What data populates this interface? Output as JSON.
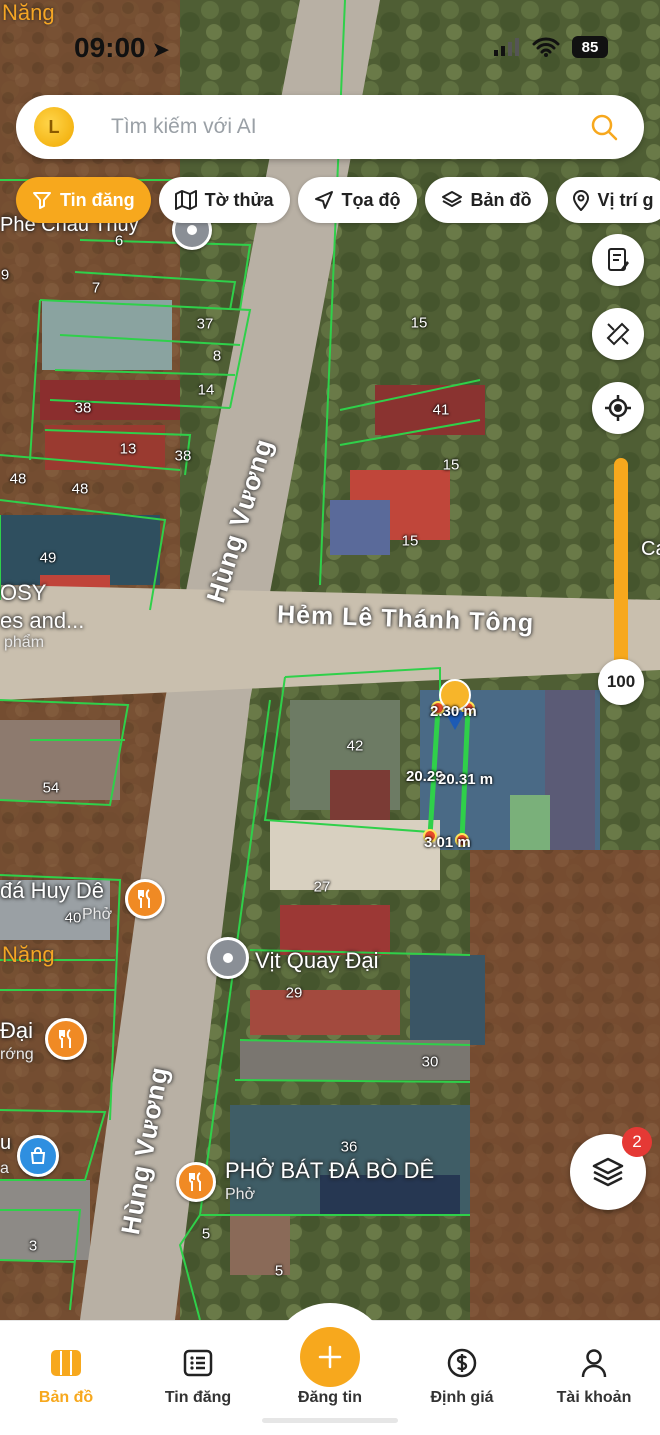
{
  "status_bar": {
    "time": "09:00",
    "battery": "85"
  },
  "search": {
    "placeholder": "Tìm kiếm với AI",
    "logo_text": "L"
  },
  "filter_chips": [
    {
      "label": "Tin đăng",
      "icon": "filter-icon",
      "active": true
    },
    {
      "label": "Tờ thửa",
      "icon": "map-icon",
      "active": false
    },
    {
      "label": "Tọa độ",
      "icon": "navigation-arrow-icon",
      "active": false
    },
    {
      "label": "Bản đồ",
      "icon": "layers-icon",
      "active": false
    },
    {
      "label": "Vị trí g",
      "icon": "location-pin-icon",
      "active": false
    }
  ],
  "map_tools": [
    "edit-note-icon",
    "ruler-pencil-icon",
    "my-location-icon"
  ],
  "zoom_slider": {
    "value": "100",
    "accent": "#f7a81d"
  },
  "layers_button": {
    "badge": "2"
  },
  "map": {
    "roads": {
      "main_1": "Hùng Vương",
      "main_2": "Hùng Vương",
      "alley": "Hẻm Lê Thánh Tông"
    },
    "parcel_numbers": [
      "6",
      "7",
      "9",
      "37",
      "8",
      "14",
      "38",
      "13",
      "38",
      "48",
      "48",
      "49",
      "15",
      "41",
      "15",
      "15",
      "42",
      "54",
      "40",
      "27",
      "29",
      "30",
      "36",
      "5",
      "5",
      "3"
    ],
    "pois": {
      "phe_chau_thuy": "Phe Châu Thuỷ",
      "cosy": "OSY",
      "cosy_2": "es and...",
      "cosy_3": "phẩm",
      "huy_de": "đá Huy Dê",
      "huy_de_sub": "Phở",
      "vit_quay": "Vịt Quay Đại",
      "dai": "Đại",
      "dai_sub": "rớng",
      "pho_bat_da": "PHỞ BÁT ĐÁ BÒ DÊ",
      "pho_bat_da_sub": "Phở",
      "nang_top": "Năng",
      "nang_mid": "Năng",
      "right_edge": "Ca",
      "left_u": "u",
      "left_a": "a"
    },
    "measurements": {
      "top": "2.30 m",
      "left": "20.29",
      "right": "20.31 m",
      "bottom": "3.01 m"
    }
  },
  "bottom_nav": [
    {
      "label": "Bản đồ",
      "icon": "map-book-icon",
      "active": true
    },
    {
      "label": "Tin đăng",
      "icon": "list-icon",
      "active": false
    },
    {
      "label": "Đăng tin",
      "icon": "plus-icon",
      "active": false
    },
    {
      "label": "Định giá",
      "icon": "dollar-circle-icon",
      "active": false
    },
    {
      "label": "Tài khoản",
      "icon": "user-icon",
      "active": false
    }
  ],
  "colors": {
    "accent": "#f7a81d",
    "parcel_line": "#2fd04a",
    "badge": "#e53935"
  }
}
